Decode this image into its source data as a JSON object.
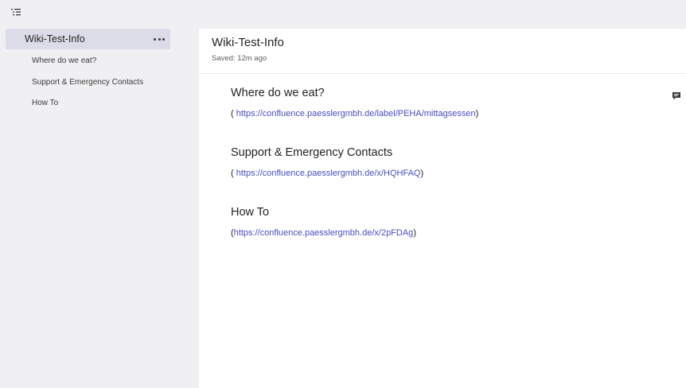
{
  "toolbar": {
    "toc_icon": "table-of-contents-icon"
  },
  "sidebar": {
    "items": [
      {
        "label": "Wiki-Test-Info",
        "selected": true
      },
      {
        "label": "Where do we eat?"
      },
      {
        "label": "Support & Emergency Contacts"
      },
      {
        "label": "How To"
      }
    ],
    "more_icon": "ellipsis-icon"
  },
  "page": {
    "title": "Wiki-Test-Info",
    "saved_status": "Saved: 12m ago",
    "comment_icon": "comment-icon",
    "sections": [
      {
        "heading": "Where do we eat?",
        "prefix": "( ",
        "link": "https://confluence.paesslergmbh.de/label/PEHA/mittagsessen",
        "suffix": ")"
      },
      {
        "heading": "Support & Emergency Contacts",
        "prefix": "( ",
        "link": "https://confluence.paesslergmbh.de/x/HQHFAQ",
        "suffix": ")"
      },
      {
        "heading": "How To",
        "prefix": "(",
        "link": "https://confluence.paesslergmbh.de/x/2pFDAg",
        "suffix": ")"
      }
    ]
  },
  "colors": {
    "accent": "#4a4fc0",
    "sidebar_bg": "#f0f0f3",
    "selected_bg": "#dcdce8"
  }
}
